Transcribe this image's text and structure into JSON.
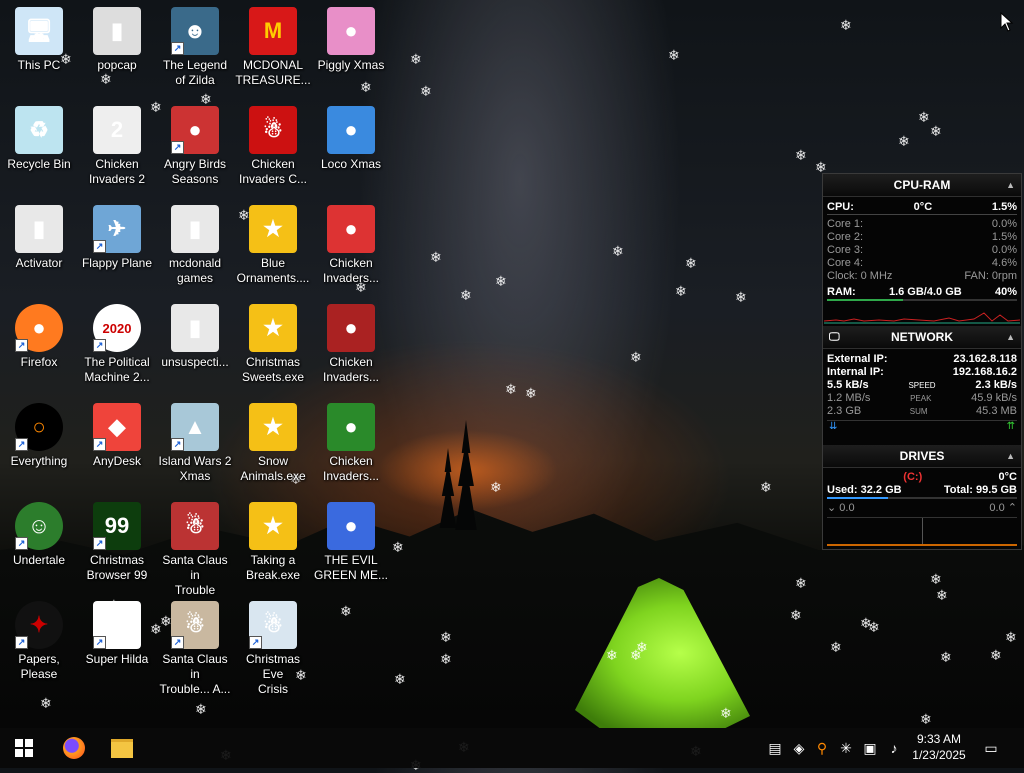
{
  "desktop": {
    "icons": [
      {
        "id": "this-pc",
        "label": "This PC",
        "glyph": "🖥"
      },
      {
        "id": "recycle-bin",
        "label": "Recycle Bin",
        "glyph": "♻"
      },
      {
        "id": "activator",
        "label": "Activator",
        "glyph": "▮"
      },
      {
        "id": "firefox",
        "label": "Firefox",
        "glyph": "●"
      },
      {
        "id": "everything",
        "label": "Everything",
        "glyph": "○"
      },
      {
        "id": "undertale",
        "label": "Undertale",
        "glyph": "☺"
      },
      {
        "id": "papers-please",
        "label": "Papers, Please",
        "glyph": "✦"
      },
      {
        "id": "popcap",
        "label": "popcap",
        "glyph": "▮"
      },
      {
        "id": "chicken-invaders-2",
        "label": "Chicken\nInvaders 2",
        "glyph": "2"
      },
      {
        "id": "flappy-plane",
        "label": "Flappy Plane",
        "glyph": "✈"
      },
      {
        "id": "political-machine",
        "label": "The Political\nMachine 2...",
        "glyph": "2020"
      },
      {
        "id": "anydesk",
        "label": "AnyDesk",
        "glyph": "◆"
      },
      {
        "id": "christmas-browser",
        "label": "Christmas\nBrowser 99",
        "glyph": "99"
      },
      {
        "id": "super-hilda",
        "label": "Super Hilda",
        "glyph": "▦"
      },
      {
        "id": "legend-of-zilda",
        "label": "The Legend\nof Zilda",
        "glyph": "☻"
      },
      {
        "id": "angry-birds",
        "label": "Angry Birds\nSeasons",
        "glyph": "●"
      },
      {
        "id": "mcdonald-games",
        "label": "mcdonald\ngames",
        "glyph": "▮"
      },
      {
        "id": "unsuspecti",
        "label": "unsuspecti...",
        "glyph": "▮"
      },
      {
        "id": "island-wars",
        "label": "Island Wars 2\nXmas",
        "glyph": "▲"
      },
      {
        "id": "santa-trouble",
        "label": "Santa Claus in\nTrouble",
        "glyph": "☃"
      },
      {
        "id": "santa-trouble-a",
        "label": "Santa Claus in\nTrouble... A...",
        "glyph": "☃"
      },
      {
        "id": "mcdonal-treasure",
        "label": "MCDONAL\nTREASURE...",
        "glyph": "M"
      },
      {
        "id": "chicken-invaders-c",
        "label": "Chicken\nInvaders C...",
        "glyph": "☃"
      },
      {
        "id": "blue-ornaments",
        "label": "Blue\nOrnaments....",
        "glyph": "★"
      },
      {
        "id": "christmas-sweets",
        "label": "Christmas\nSweets.exe",
        "glyph": "★"
      },
      {
        "id": "snow-animals",
        "label": "Snow\nAnimals.exe",
        "glyph": "★"
      },
      {
        "id": "taking-a-break",
        "label": "Taking a\nBreak.exe",
        "glyph": "★"
      },
      {
        "id": "christmas-eve-crisis",
        "label": "Christmas Eve\nCrisis",
        "glyph": "☃"
      },
      {
        "id": "piggly-xmas",
        "label": "Piggly Xmas",
        "glyph": "●"
      },
      {
        "id": "loco-xmas",
        "label": "Loco Xmas",
        "glyph": "●"
      },
      {
        "id": "chicken-invaders-a",
        "label": "Chicken\nInvaders...",
        "glyph": "●"
      },
      {
        "id": "chicken-invaders-b",
        "label": "Chicken\nInvaders...",
        "glyph": "●"
      },
      {
        "id": "chicken-invaders-d",
        "label": "Chicken\nInvaders...",
        "glyph": "●"
      },
      {
        "id": "evil-green-me",
        "label": "THE EVIL\nGREEN ME...",
        "glyph": "●"
      }
    ]
  },
  "gadget": {
    "cpu_ram": {
      "title": "CPU-RAM",
      "cpu_label": "CPU:",
      "cpu_temp": "0°C",
      "cpu_pct": "1.5%",
      "cores": [
        {
          "label": "Core 1:",
          "value": "0.0%"
        },
        {
          "label": "Core 2:",
          "value": "1.5%"
        },
        {
          "label": "Core 3:",
          "value": "0.0%"
        },
        {
          "label": "Core 4:",
          "value": "4.6%"
        }
      ],
      "clock": "Clock: 0 MHz",
      "fan": "FAN: 0rpm",
      "ram_label": "RAM:",
      "ram_used": "1.6 GB/4.0 GB",
      "ram_pct": "40%"
    },
    "network": {
      "title": "NETWORK",
      "external_label": "External IP:",
      "external_ip": "23.162.8.118",
      "internal_label": "Internal IP:",
      "internal_ip": "192.168.16.2",
      "speed_down": "5.5 kB/s",
      "speed_label": "SPEED",
      "speed_up": "2.3 kB/s",
      "peak_down": "1.2 MB/s",
      "peak_label": "PEAK",
      "peak_up": "45.9 kB/s",
      "sum_down": "2.3 GB",
      "sum_label": "SUM",
      "sum_up": "45.3 MB"
    },
    "drives": {
      "title": "DRIVES",
      "drive": "(C:)",
      "temp": "0°C",
      "used": "Used: 32.2 GB",
      "total": "Total: 99.5 GB",
      "read": "0.0",
      "write": "0.0"
    }
  },
  "taskbar": {
    "time": "9:33 AM",
    "date": "1/23/2025",
    "pinned": [
      {
        "id": "start",
        "glyph": "⊞"
      },
      {
        "id": "firefox",
        "glyph": "●"
      },
      {
        "id": "file-explorer",
        "glyph": "▰"
      }
    ],
    "tray": [
      {
        "id": "network-tray",
        "glyph": "▤"
      },
      {
        "id": "drop",
        "glyph": "💧"
      },
      {
        "id": "everything-tray",
        "glyph": "⚲"
      },
      {
        "id": "snowflake",
        "glyph": "✳"
      },
      {
        "id": "network-wired",
        "glyph": "▣"
      },
      {
        "id": "volume",
        "glyph": "🔊"
      }
    ]
  }
}
